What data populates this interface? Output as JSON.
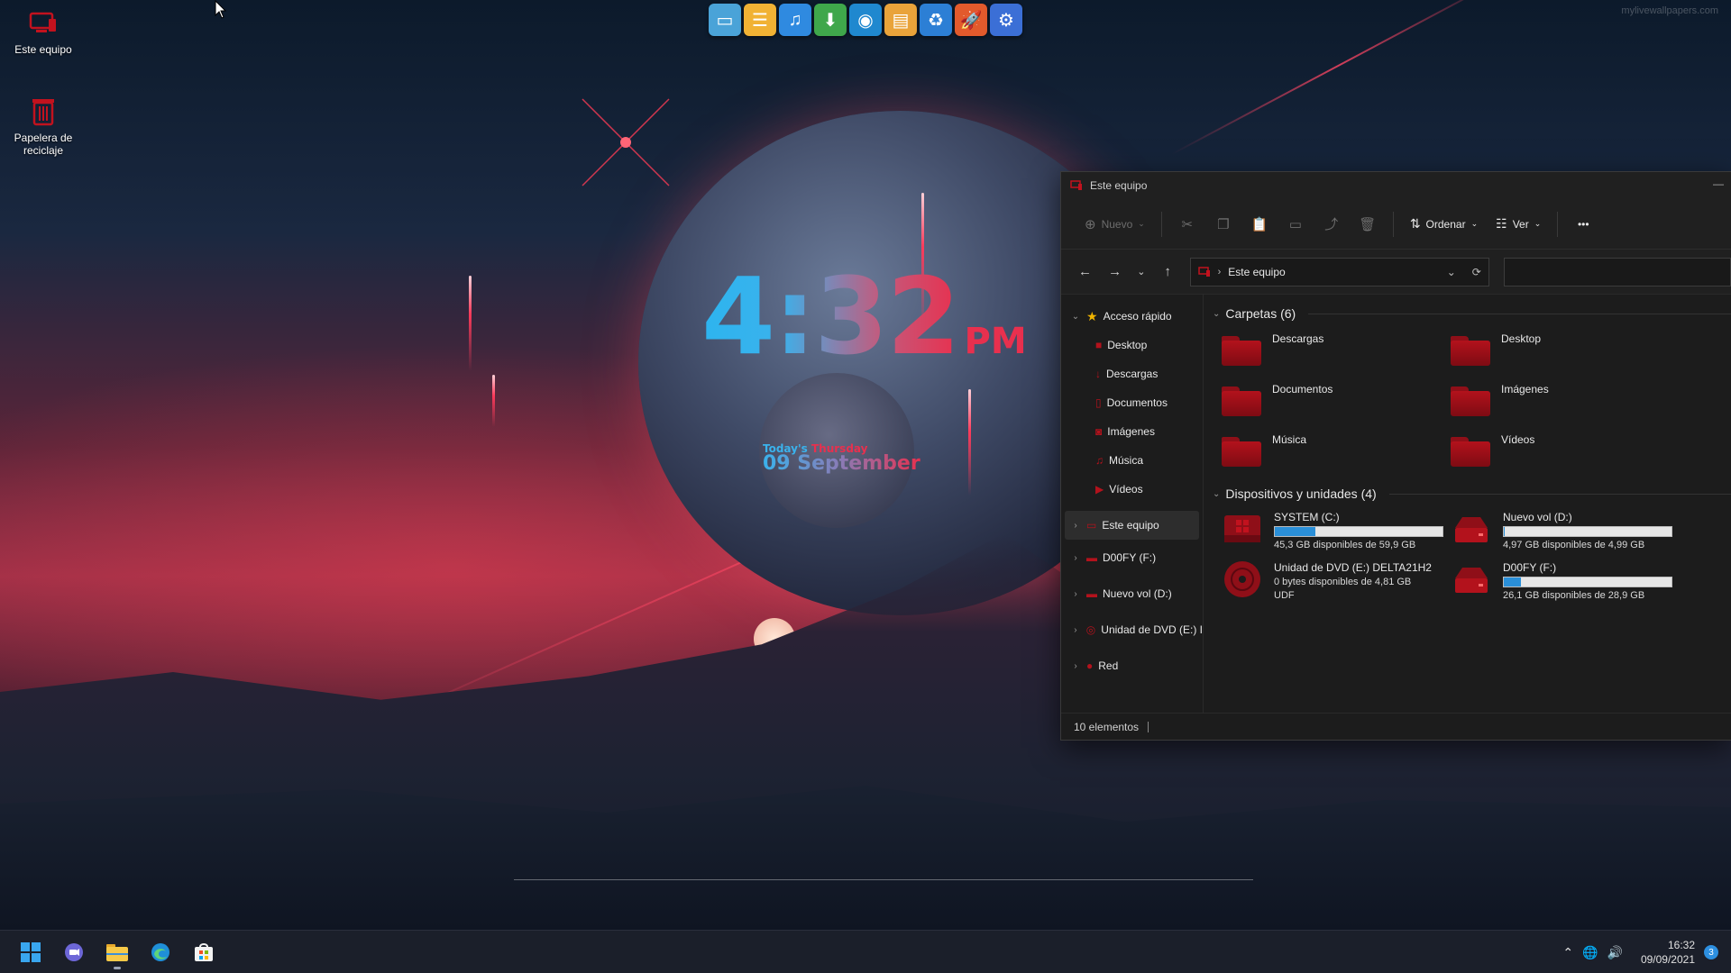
{
  "desktop": {
    "watermark": "mylivewallpapers.com",
    "icons": [
      {
        "label": "Este equipo",
        "icon": "computer-icon"
      },
      {
        "label": "Papelera de reciclaje",
        "icon": "recycle-bin-icon"
      }
    ],
    "dock": [
      {
        "icon": "desktop-monitor-icon",
        "color": "#4aa3d8"
      },
      {
        "icon": "drawer-icon",
        "color": "#f1b234"
      },
      {
        "icon": "music-note-icon",
        "color": "#2f8ae0"
      },
      {
        "icon": "download-icon",
        "color": "#3fa74b"
      },
      {
        "icon": "camera-lens-icon",
        "color": "#1f88cf"
      },
      {
        "icon": "browser-window-icon",
        "color": "#e9a33a"
      },
      {
        "icon": "recycle-icon",
        "color": "#2c7fd5"
      },
      {
        "icon": "rocket-icon",
        "color": "#e25a2c"
      },
      {
        "icon": "gear-icon",
        "color": "#3b6fd6"
      }
    ]
  },
  "clock_widget": {
    "time": "4:32",
    "ampm": "PM",
    "today_label": "Today's",
    "weekday": "Thursday",
    "date": "09 September"
  },
  "explorer": {
    "title": "Este equipo",
    "toolbar": {
      "new_label": "Nuevo",
      "sort_label": "Ordenar",
      "view_label": "Ver",
      "more_label": "•••"
    },
    "address": {
      "path": "Este equipo"
    },
    "nav": {
      "quick_access": "Acceso rápido",
      "quick_items": [
        "Desktop",
        "Descargas",
        "Documentos",
        "Imágenes",
        "Música",
        "Vídeos"
      ],
      "this_pc": "Este equipo",
      "drives": [
        "D00FY (F:)",
        "Nuevo vol (D:)",
        "Unidad de DVD (E:) I"
      ],
      "network": "Red"
    },
    "folders_header": "Carpetas (6)",
    "folders": [
      "Descargas",
      "Desktop",
      "Documentos",
      "Imágenes",
      "Música",
      "Vídeos"
    ],
    "devices_header": "Dispositivos y unidades (4)",
    "devices": [
      {
        "name": "SYSTEM (C:)",
        "detail": "45,3 GB disponibles de 59,9 GB",
        "used_fraction": 0.24,
        "icon": "windows-drive-icon"
      },
      {
        "name": "Nuevo vol (D:)",
        "detail": "4,97 GB disponibles de 4,99 GB",
        "used_fraction": 0.004,
        "icon": "drive-icon"
      },
      {
        "name": "Unidad de DVD (E:) DELTA21H2",
        "detail": "0 bytes disponibles de 4,81 GB",
        "extra": "UDF",
        "icon": "dvd-icon"
      },
      {
        "name": "D00FY (F:)",
        "detail": "26,1 GB disponibles de 28,9 GB",
        "used_fraction": 0.1,
        "icon": "drive-icon"
      }
    ],
    "status": "10 elementos"
  },
  "taskbar": {
    "apps": [
      "windows-start-icon",
      "teams-chat-icon",
      "file-explorer-icon",
      "edge-icon",
      "store-icon"
    ],
    "time": "16:32",
    "date": "09/09/2021",
    "notifications": "3"
  },
  "colors": {
    "accent_red": "#b3121c",
    "accent_blue": "#2a8fd8",
    "clock_blue": "#3ab2ec",
    "clock_red": "#e8304e"
  }
}
